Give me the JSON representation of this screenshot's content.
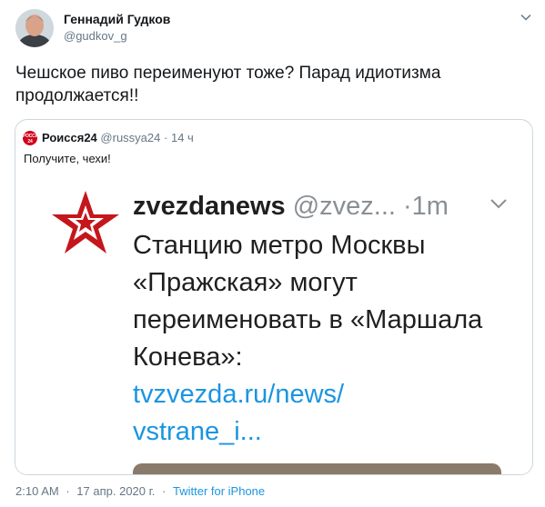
{
  "tweet": {
    "author_name": "Геннадий Гудков",
    "author_handle": "@gudkov_g",
    "text": "Чешское пиво переименуют тоже? Парад идиотизма продолжается!!",
    "time": "2:10 AM",
    "date": "17 апр. 2020 г.",
    "separator": "·",
    "source": "Twitter for iPhone"
  },
  "quote": {
    "avatar_text": "РОССИЯ 24",
    "name": "Роисся24",
    "handle": "@russya24",
    "separator": "·",
    "time": "14 ч",
    "text": "Получите, чехи!"
  },
  "inner_post": {
    "name": "zvezdanews",
    "handle": "@zvez...",
    "time": "·1m",
    "body": "Станцию метро Москвы «Пражская» могут переименовать в «Маршала Конева»:",
    "link_line1": "tvzvezda.ru/news/",
    "link_line2": "vstrane_i..."
  },
  "colors": {
    "text": "#14171a",
    "muted": "#657786",
    "link": "#1b95e0",
    "star_red": "#c4161c"
  },
  "icons": [
    "chevron-down-icon",
    "red-star-logo-icon"
  ]
}
